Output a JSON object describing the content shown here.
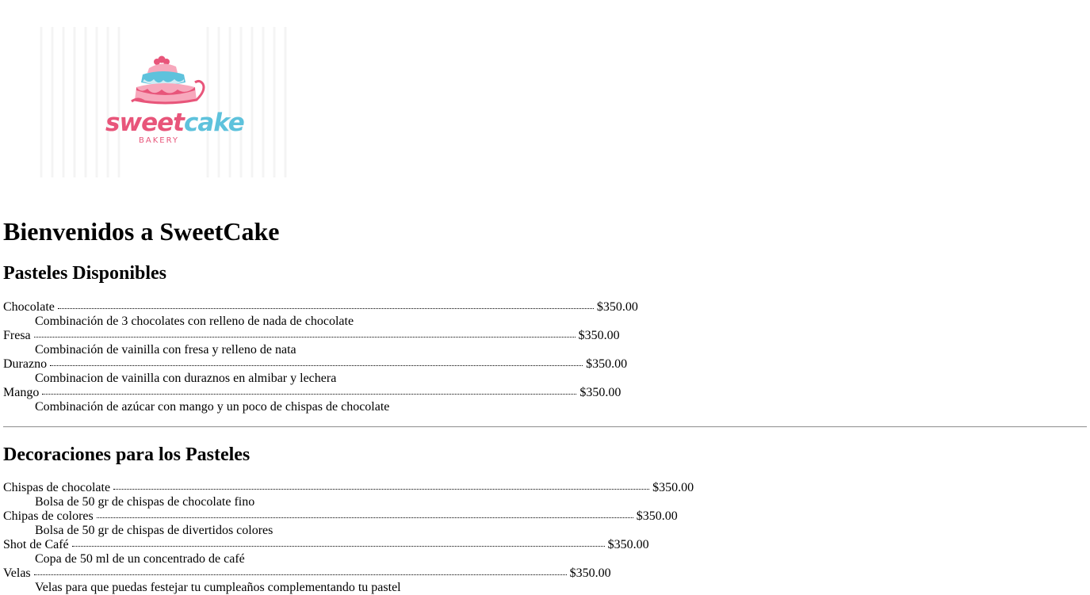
{
  "logo": {
    "word_sweet": "sweet",
    "word_cake": "cake",
    "subtitle": "BAKERY",
    "colors": {
      "pink": "#e8557a",
      "blue": "#5ec2dc",
      "light_pink": "#f7a8bc"
    }
  },
  "page": {
    "title": "Bienvenidos a SweetCake"
  },
  "cakes": {
    "heading": "Pasteles Disponibles",
    "items": [
      {
        "name": "Chocolate",
        "price": "$350.00",
        "description": "Combinación de 3 chocolates con relleno de nada de chocolate"
      },
      {
        "name": "Fresa",
        "price": "$350.00",
        "description": "Combinación de vainilla con fresa y relleno de nata"
      },
      {
        "name": "Durazno",
        "price": "$350.00",
        "description": "Combinacion de vainilla con duraznos en almibar y lechera"
      },
      {
        "name": "Mango",
        "price": "$350.00",
        "description": "Combinación de azúcar con mango y un poco de chispas de chocolate"
      }
    ]
  },
  "decorations": {
    "heading": "Decoraciones para los Pasteles",
    "items": [
      {
        "name": "Chispas de chocolate",
        "price": "$350.00",
        "description": "Bolsa de 50 gr de chispas de chocolate fino"
      },
      {
        "name": "Chipas de colores",
        "price": "$350.00",
        "description": "Bolsa de 50 gr de chispas de divertidos colores"
      },
      {
        "name": "Shot de Café",
        "price": "$350.00",
        "description": "Copa de 50 ml de un concentrado de café"
      },
      {
        "name": "Velas",
        "price": "$350.00",
        "description": "Velas para que puedas festejar tu cumpleaños complementando tu pastel"
      }
    ]
  }
}
